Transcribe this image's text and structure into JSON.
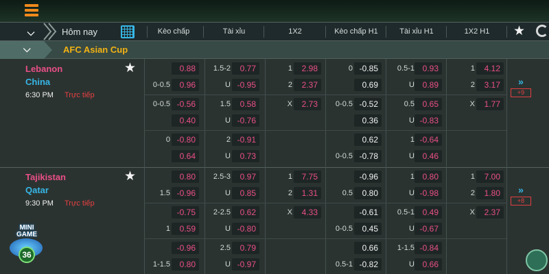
{
  "colors": {
    "accent_orange": "#f08a1c",
    "home": "#ea4f86",
    "away": "#36b7e6",
    "live": "#e64040",
    "league": "#f3b214"
  },
  "nav": {
    "today": "Hôm nay",
    "columns": [
      "Kèo chấp",
      "Tài xỉu",
      "1X2",
      "Kèo chấp H1",
      "Tài xỉu H1",
      "1X2 H1"
    ],
    "icons": [
      "menu-icon",
      "chevron-down-icon",
      "calendar-icon",
      "star-icon",
      "refresh-icon"
    ]
  },
  "league": {
    "name": "AFC Asian Cup"
  },
  "matches": [
    {
      "home": "Lebanon",
      "away": "China",
      "time": "6:30 PM",
      "status": "Trực tiếp",
      "more": "+9",
      "rows": [
        {
          "hcp": "",
          "hcp_val": "0.88",
          "hcp2": "0-0.5",
          "hcp_val2": "0.96",
          "ou": "1.5-2",
          "ou_val": "0.77",
          "ou2": "U",
          "ou_val2": "-0.95",
          "x12": "1",
          "x12_val": "2.98",
          "x12b": "2",
          "x12_val2": "2.37",
          "h1": "0",
          "h1_val": "-0.85",
          "h1b": "",
          "h1_val2": "0.69",
          "ouh1": "0.5-1",
          "ouh1_val": "0.93",
          "ouh1b": "U",
          "ouh1_val2": "0.89",
          "x2h1": "1",
          "x2h1_val": "4.12",
          "x2h1b": "2",
          "x2h1_val2": "3.17"
        },
        {
          "hcp": "0-0.5",
          "hcp_val": "-0.56",
          "hcp2": "",
          "hcp_val2": "0.40",
          "ou": "1.5",
          "ou_val": "0.58",
          "ou2": "U",
          "ou_val2": "-0.76",
          "x12": "X",
          "x12_val": "2.73",
          "x12b": "",
          "x12_val2": "",
          "h1": "0-0.5",
          "h1_val": "-0.52",
          "h1b": "",
          "h1_val2": "0.36",
          "ouh1": "0.5",
          "ouh1_val": "0.65",
          "ouh1b": "U",
          "ouh1_val2": "-0.83",
          "x2h1": "X",
          "x2h1_val": "1.77",
          "x2h1b": "",
          "x2h1_val2": ""
        },
        {
          "hcp": "0",
          "hcp_val": "-0.80",
          "hcp2": "",
          "hcp_val2": "0.64",
          "ou": "2",
          "ou_val": "-0.91",
          "ou2": "U",
          "ou_val2": "0.73",
          "x12": "",
          "x12_val": "",
          "x12b": "",
          "x12_val2": "",
          "h1": "",
          "h1_val": "0.62",
          "h1b": "0-0.5",
          "h1_val2": "-0.78",
          "ouh1": "1",
          "ouh1_val": "-0.64",
          "ouh1b": "U",
          "ouh1_val2": "0.46",
          "x2h1": "",
          "x2h1_val": "",
          "x2h1b": "",
          "x2h1_val2": ""
        }
      ]
    },
    {
      "home": "Tajikistan",
      "away": "Qatar",
      "time": "9:30 PM",
      "status": "Trực tiếp",
      "more": "+8",
      "rows": [
        {
          "hcp": "",
          "hcp_val": "0.80",
          "hcp2": "1.5",
          "hcp_val2": "-0.96",
          "ou": "2.5-3",
          "ou_val": "0.97",
          "ou2": "U",
          "ou_val2": "0.85",
          "x12": "1",
          "x12_val": "7.75",
          "x12b": "2",
          "x12_val2": "1.31",
          "h1": "",
          "h1_val": "-0.96",
          "h1b": "0.5",
          "h1_val2": "0.80",
          "ouh1": "1",
          "ouh1_val": "0.80",
          "ouh1b": "U",
          "ouh1_val2": "-0.98",
          "x2h1": "1",
          "x2h1_val": "7.00",
          "x2h1b": "2",
          "x2h1_val2": "1.80"
        },
        {
          "hcp": "",
          "hcp_val": "-0.75",
          "hcp2": "1",
          "hcp_val2": "0.59",
          "ou": "2-2.5",
          "ou_val": "0.62",
          "ou2": "U",
          "ou_val2": "-0.80",
          "x12": "X",
          "x12_val": "4.33",
          "x12b": "",
          "x12_val2": "",
          "h1": "",
          "h1_val": "-0.61",
          "h1b": "0-0.5",
          "h1_val2": "0.45",
          "ouh1": "0.5-1",
          "ouh1_val": "0.49",
          "ouh1b": "U",
          "ouh1_val2": "-0.67",
          "x2h1": "X",
          "x2h1_val": "2.37",
          "x2h1b": "",
          "x2h1_val2": ""
        },
        {
          "hcp": "",
          "hcp_val": "-0.96",
          "hcp2": "1-1.5",
          "hcp_val2": "0.80",
          "ou": "2.5",
          "ou_val": "0.79",
          "ou2": "U",
          "ou_val2": "-0.97",
          "x12": "",
          "x12_val": "",
          "x12b": "",
          "x12_val2": "",
          "h1": "",
          "h1_val": "0.66",
          "h1b": "0.5-1",
          "h1_val2": "-0.82",
          "ouh1": "1-1.5",
          "ouh1_val": "-0.84",
          "ouh1b": "U",
          "ouh1_val2": "0.66",
          "x2h1": "",
          "x2h1_val": "",
          "x2h1b": "",
          "x2h1_val2": ""
        }
      ]
    }
  ],
  "minigame": {
    "label_1": "MINI",
    "label_2": "GAME",
    "count": "36"
  }
}
